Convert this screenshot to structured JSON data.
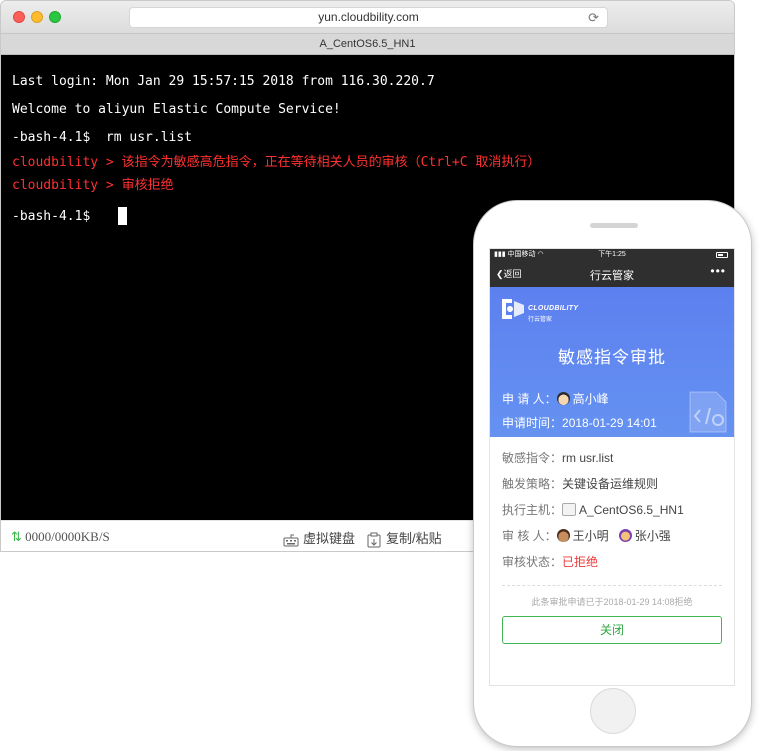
{
  "browser": {
    "url": "yun.cloudbility.com",
    "tab_title": "A_CentOS6.5_HN1"
  },
  "terminal": {
    "lines": [
      "Last login: Mon Jan 29 15:57:15 2018 from 116.30.220.7",
      "Welcome to aliyun Elastic Compute Service!",
      "-bash-4.1$  rm usr.list",
      "cloudbility > 该指令为敏感高危指令，正在等待相关人员的审核（Ctrl+C 取消执行）",
      "cloudbility > 审核拒绝",
      "-bash-4.1$"
    ]
  },
  "statusbar": {
    "speed": "0000/0000KB/S",
    "keyboard_label": "虚拟键盘",
    "copy_label": "复制/粘贴"
  },
  "phone": {
    "carrier": "中国移动",
    "time": "下午1:25",
    "nav": {
      "back": "返回",
      "title": "行云管家",
      "more": "•••"
    },
    "brand": {
      "name": "CLOUDBILITY",
      "sub": "行云管家"
    },
    "hero": {
      "title": "敏感指令审批",
      "applicant_label": "申  请  人：",
      "applicant": "高小峰",
      "time_label": "申请时间：",
      "time": "2018-01-29 14:01"
    },
    "details": {
      "command_label": "敏感指令：",
      "command": "rm usr.list",
      "policy_label": "触发策略：",
      "policy": "关键设备运维规则",
      "host_label": "执行主机：",
      "host": "A_CentOS6.5_HN1",
      "reviewers_label": "审  核  人：",
      "reviewer_1": "王小明",
      "reviewer_2": "张小强",
      "status_label": "审核状态：",
      "status": "已拒绝"
    },
    "footnote": "此条审批申请已于2018-01-29 14:08拒绝",
    "close_label": "关闭"
  },
  "colors": {
    "hero_blue": "#6188f0",
    "terminal_red": "#ff3030",
    "status_red": "#f03838",
    "close_green": "#3fb653"
  }
}
